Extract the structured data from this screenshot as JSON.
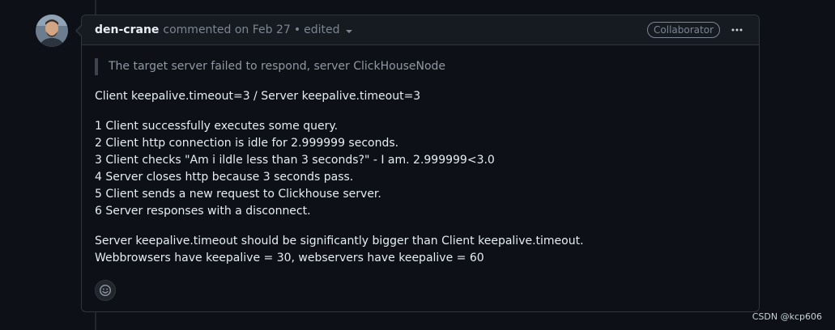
{
  "comment": {
    "author": "den-crane",
    "action": "commented on",
    "date": "Feb 27",
    "bullet": "•",
    "edited_label": "edited",
    "role_badge": "Collaborator",
    "avatar_icon": "user-avatar-photo",
    "menu_icon": "kebab-horizontal-icon",
    "body": {
      "blockquote": "The target server failed to respond, server ClickHouseNode",
      "timeouts_line": "Client keepalive.timeout=3 / Server keepalive.timeout=3",
      "steps": [
        "1 Client successfully executes some query.",
        "2 Client http connection is idle for 2.999999 seconds.",
        "3 Client checks \"Am i ildle less than 3 seconds?\" - I am. 2.999999<3.0",
        "4 Server closes http because 3 seconds pass.",
        "5 Client sends a new request to Clickhouse server.",
        "6 Server responses with a disconnect."
      ],
      "conclusion_1": "Server keepalive.timeout should be significantly bigger than Client keepalive.timeout.",
      "conclusion_2": "Webbrowsers have keepalive = 30, webservers have keepalive = 60"
    },
    "reaction_icon": "smiley-icon"
  },
  "watermark": "CSDN @kcp606",
  "colors": {
    "background": "#0d1117",
    "header_bg": "#161b22",
    "border": "#30363d",
    "text": "#e6edf3",
    "muted": "#7d8590"
  }
}
